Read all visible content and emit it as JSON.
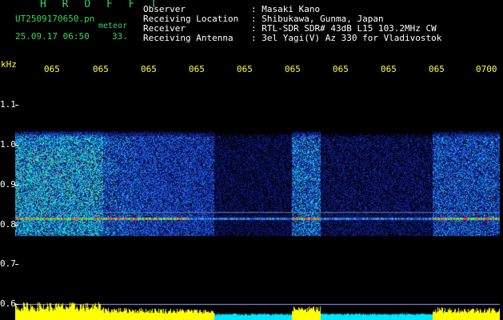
{
  "header": {
    "logo": "H R O F F T",
    "filename": "UT2509170650.pn",
    "file_suffix": "meteor",
    "datetime": "25.09.17 06:50",
    "count": "33.",
    "fields": [
      {
        "label": "Observer",
        "value": ": Masaki Kano"
      },
      {
        "label": "Receiving Location",
        "value": ": Shibukawa, Gunma, Japan"
      },
      {
        "label": "Receiver",
        "value": ": RTL-SDR SDR# 43dB L15 103.2MHz CW"
      },
      {
        "label": "Receiving Antenna",
        "value": ": 3el Yagi(V) Az 330 for Vladivostok"
      }
    ]
  },
  "axis": {
    "unit": "kHz",
    "y_ticks": [
      "1.1",
      "1.0",
      "0.9",
      "0.8",
      "0.7",
      "0.6"
    ],
    "x_ticks": [
      "065",
      "065",
      "065",
      "065",
      "065",
      "065",
      "065",
      "065",
      "065",
      "0700"
    ]
  },
  "colors": {
    "background": "#000000",
    "label_green": "#39d85a",
    "tick_yellow": "#ffff33",
    "activity_yellow": "#ffff00",
    "activity_cyan": "#00e5ff"
  }
}
